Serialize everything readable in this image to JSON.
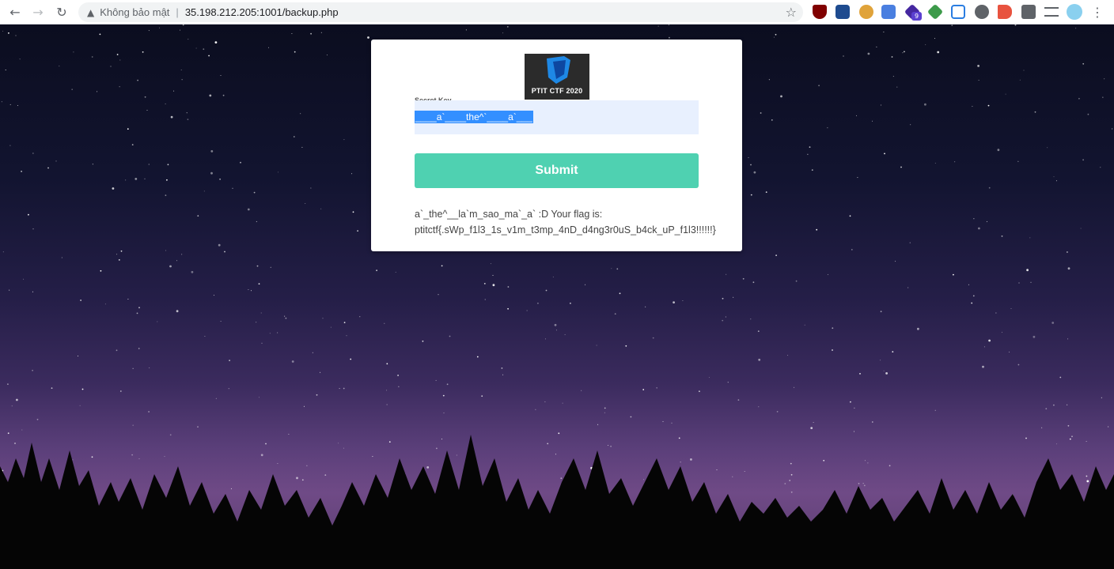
{
  "browser": {
    "back_icon": "←",
    "forward_icon": "→",
    "reload_icon": "↻",
    "security_icon": "▲",
    "security_label": "Không bảo mật",
    "separator": "|",
    "url": "35.198.212.205:1001/backup.php",
    "bookmark_icon": "☆",
    "extension_badge": "9",
    "menu_icon": "⋮",
    "extensions": [
      "ublock-icon",
      "blue-j-icon",
      "cookie-icon",
      "translate-icon",
      "purple-cube-icon",
      "green-cube-icon",
      "blue-window-icon",
      "gear-icon",
      "flag-icon",
      "puzzle-icon",
      "playlist-icon"
    ]
  },
  "card": {
    "logo_text": "PTIT CTF 2020",
    "field_label": "Secret Key",
    "field_value": "____a`____the^`____a`___",
    "submit_label": "Submit",
    "result_line1": "a`_the^__la`m_sao_ma`_a` :D Your flag is:",
    "result_line2": "ptitctf{.sWp_f1l3_1s_v1m_t3mp_4nD_d4ng3r0uS_b4ck_uP_f1l3!!!!!!}"
  },
  "colors": {
    "submit_bg": "#4fd1b1",
    "input_bg": "#e8f0fe",
    "selection": "#338fff"
  }
}
